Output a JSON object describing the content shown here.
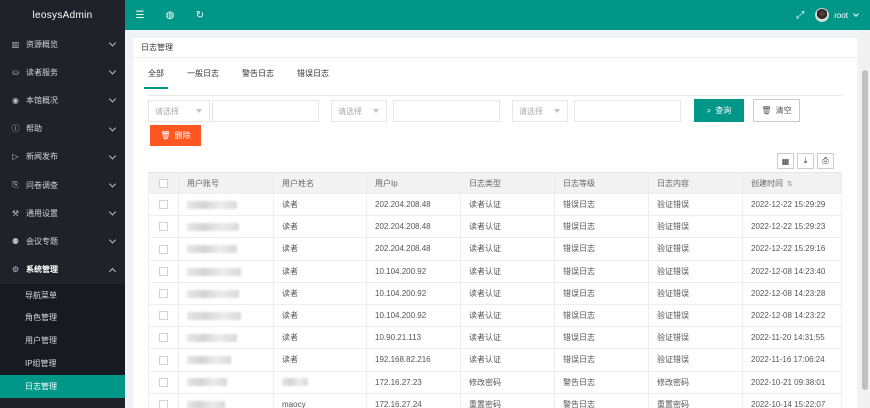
{
  "app": {
    "logo": "leosysAdmin"
  },
  "sidebar": {
    "items": [
      {
        "label": "资源概览",
        "icon": "resource-icon",
        "glyph": "▥"
      },
      {
        "label": "读者服务",
        "icon": "reader-icon",
        "glyph": "⛀"
      },
      {
        "label": "本馆概况",
        "icon": "globe-icon",
        "glyph": "◉"
      },
      {
        "label": "帮助",
        "icon": "help-icon",
        "glyph": "ⓘ"
      },
      {
        "label": "新闻发布",
        "icon": "news-icon",
        "glyph": "▷"
      },
      {
        "label": "问卷调查",
        "icon": "survey-icon",
        "glyph": "⎘"
      },
      {
        "label": "通用设置",
        "icon": "settings-tools-icon",
        "glyph": "⚒"
      },
      {
        "label": "会议专题",
        "icon": "meeting-icon",
        "glyph": "⚉"
      },
      {
        "label": "系统管理",
        "icon": "gear-icon",
        "glyph": "⚙"
      }
    ],
    "submenu": [
      {
        "label": "导航菜单",
        "active": false
      },
      {
        "label": "角色管理",
        "active": false
      },
      {
        "label": "用户管理",
        "active": false
      },
      {
        "label": "IP组管理",
        "active": false
      },
      {
        "label": "日志管理",
        "active": true
      }
    ]
  },
  "topbar": {
    "icons": [
      "menu-toggle-icon",
      "globe-icon",
      "refresh-icon"
    ],
    "glyphs": [
      "☰",
      "◍",
      "↻"
    ],
    "fullscreen_glyph": "⤢",
    "user": "root"
  },
  "card": {
    "title": "日志管理"
  },
  "tabs": [
    {
      "label": "全部",
      "active": true
    },
    {
      "label": "一般日志",
      "active": false
    },
    {
      "label": "警告日志",
      "active": false
    },
    {
      "label": "错误日志",
      "active": false
    }
  ],
  "filters": {
    "select_placeholder": "请选择",
    "search_label": "查询",
    "clear_label": "清空",
    "delete_label": "删除"
  },
  "toolbar": {
    "glyphs": [
      "▦",
      "⤓",
      "⎙"
    ]
  },
  "table": {
    "headers": [
      "用户账号",
      "用户姓名",
      "用户Ip",
      "日志类型",
      "日志等级",
      "日志内容",
      "创建时间"
    ],
    "rows": [
      {
        "account": "",
        "name": "读者",
        "ip": "202.204.208.48",
        "type": "读者认证",
        "level": "错误日志",
        "level_kind": "error",
        "content": "验证错误",
        "time": "2022-12-22 15:29:29"
      },
      {
        "account": "",
        "name": "读者",
        "ip": "202.204.208.48",
        "type": "读者认证",
        "level": "错误日志",
        "level_kind": "error",
        "content": "验证错误",
        "time": "2022-12-22 15:29:23"
      },
      {
        "account": "",
        "name": "读者",
        "ip": "202.204.208.48",
        "type": "读者认证",
        "level": "错误日志",
        "level_kind": "error",
        "content": "验证错误",
        "time": "2022-12-22 15:29:16"
      },
      {
        "account": "",
        "name": "读者",
        "ip": "10.104.200.92",
        "type": "读者认证",
        "level": "错误日志",
        "level_kind": "error",
        "content": "验证错误",
        "time": "2022-12-08 14:23:40"
      },
      {
        "account": "",
        "name": "读者",
        "ip": "10.104.200.92",
        "type": "读者认证",
        "level": "错误日志",
        "level_kind": "error",
        "content": "验证错误",
        "time": "2022-12-08 14:23:28"
      },
      {
        "account": "",
        "name": "读者",
        "ip": "10.104.200.92",
        "type": "读者认证",
        "level": "错误日志",
        "level_kind": "error",
        "content": "验证错误",
        "time": "2022-12-08 14:23:22"
      },
      {
        "account": "",
        "name": "读者",
        "ip": "10.90.21.113",
        "type": "读者认证",
        "level": "错误日志",
        "level_kind": "error",
        "content": "验证错误",
        "time": "2022-11-20 14:31:55"
      },
      {
        "account": "",
        "name": "读者",
        "ip": "192.168.82.216",
        "type": "读者认证",
        "level": "错误日志",
        "level_kind": "error",
        "content": "验证错误",
        "time": "2022-11-16 17:06:24"
      },
      {
        "account": "",
        "name": "",
        "ip": "172.16.27.23",
        "type": "修改密码",
        "level": "警告日志",
        "level_kind": "warning",
        "content": "修改密码",
        "time": "2022-10-21 09:38:01"
      },
      {
        "account": "",
        "name": "maocy",
        "ip": "172.16.27.24",
        "type": "重置密码",
        "level": "警告日志",
        "level_kind": "warning",
        "content": "重置密码",
        "time": "2022-10-14 15:22:07"
      }
    ]
  },
  "colors": {
    "primary": "#009688",
    "danger": "#ff5722",
    "warning": "#ffb800",
    "sidebar": "#20222a"
  }
}
